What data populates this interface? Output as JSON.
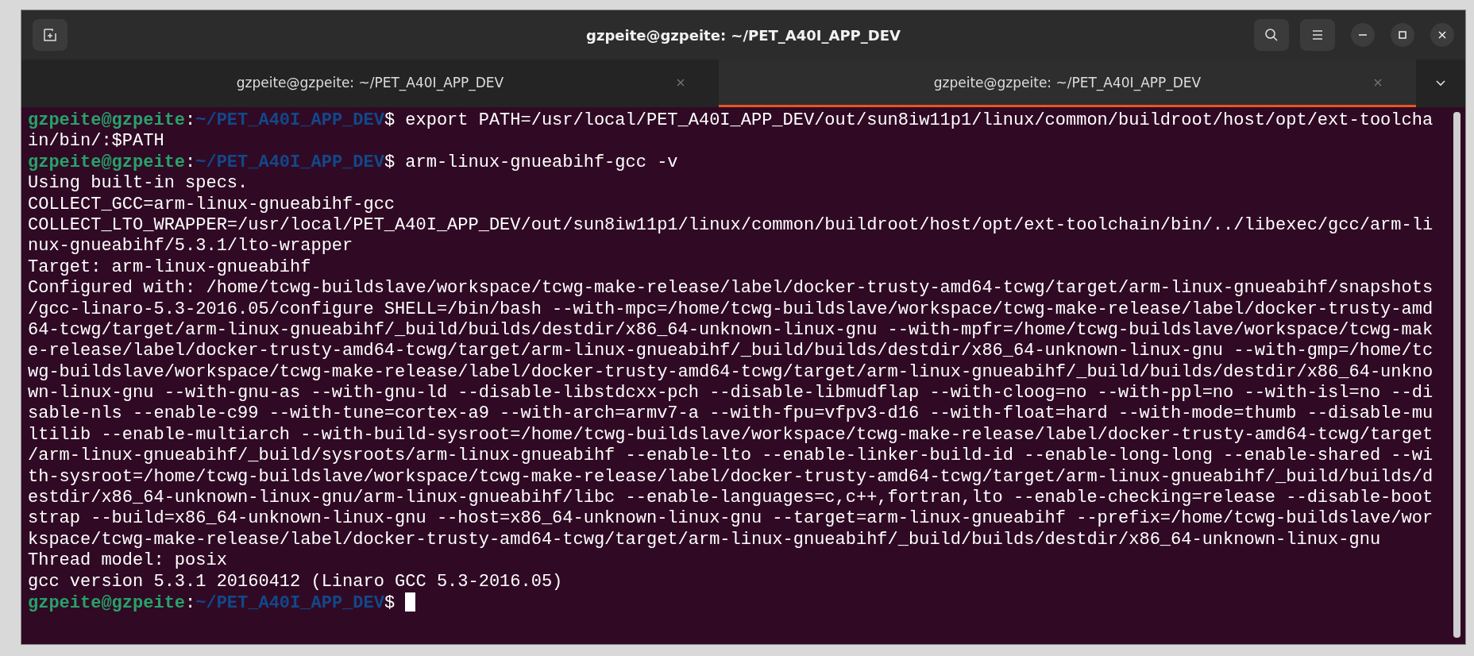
{
  "window": {
    "title": "gzpeite@gzpeite: ~/PET_A40I_APP_DEV"
  },
  "tabs": [
    {
      "label": "gzpeite@gzpeite: ~/PET_A40I_APP_DEV",
      "selected": false
    },
    {
      "label": "gzpeite@gzpeite: ~/PET_A40I_APP_DEV",
      "selected": true
    }
  ],
  "terminal": {
    "lines": [
      {
        "kind": "prompt",
        "user": "gzpeite@gzpeite",
        "separator": ":",
        "path": "~/PET_A40I_APP_DEV",
        "symbol": "$",
        "command": "export PATH=/usr/local/PET_A40I_APP_DEV/out/sun8iw11p1/linux/common/buildroot/host/opt/ext-toolcha",
        "cursor": false
      },
      {
        "kind": "output",
        "text": "in/bin/:$PATH"
      },
      {
        "kind": "prompt",
        "user": "gzpeite@gzpeite",
        "separator": ":",
        "path": "~/PET_A40I_APP_DEV",
        "symbol": "$",
        "command": "arm-linux-gnueabihf-gcc -v",
        "cursor": false
      },
      {
        "kind": "output",
        "text": "Using built-in specs."
      },
      {
        "kind": "output",
        "text": "COLLECT_GCC=arm-linux-gnueabihf-gcc"
      },
      {
        "kind": "output",
        "text": "COLLECT_LTO_WRAPPER=/usr/local/PET_A40I_APP_DEV/out/sun8iw11p1/linux/common/buildroot/host/opt/ext-toolchain/bin/../libexec/gcc/arm-li"
      },
      {
        "kind": "output",
        "text": "nux-gnueabihf/5.3.1/lto-wrapper"
      },
      {
        "kind": "output",
        "text": "Target: arm-linux-gnueabihf"
      },
      {
        "kind": "output",
        "text": "Configured with: /home/tcwg-buildslave/workspace/tcwg-make-release/label/docker-trusty-amd64-tcwg/target/arm-linux-gnueabihf/snapshots"
      },
      {
        "kind": "output",
        "text": "/gcc-linaro-5.3-2016.05/configure SHELL=/bin/bash --with-mpc=/home/tcwg-buildslave/workspace/tcwg-make-release/label/docker-trusty-amd"
      },
      {
        "kind": "output",
        "text": "64-tcwg/target/arm-linux-gnueabihf/_build/builds/destdir/x86_64-unknown-linux-gnu --with-mpfr=/home/tcwg-buildslave/workspace/tcwg-mak"
      },
      {
        "kind": "output",
        "text": "e-release/label/docker-trusty-amd64-tcwg/target/arm-linux-gnueabihf/_build/builds/destdir/x86_64-unknown-linux-gnu --with-gmp=/home/tc"
      },
      {
        "kind": "output",
        "text": "wg-buildslave/workspace/tcwg-make-release/label/docker-trusty-amd64-tcwg/target/arm-linux-gnueabihf/_build/builds/destdir/x86_64-unkno"
      },
      {
        "kind": "output",
        "text": "wn-linux-gnu --with-gnu-as --with-gnu-ld --disable-libstdcxx-pch --disable-libmudflap --with-cloog=no --with-ppl=no --with-isl=no --di"
      },
      {
        "kind": "output",
        "text": "sable-nls --enable-c99 --with-tune=cortex-a9 --with-arch=armv7-a --with-fpu=vfpv3-d16 --with-float=hard --with-mode=thumb --disable-mu"
      },
      {
        "kind": "output",
        "text": "ltilib --enable-multiarch --with-build-sysroot=/home/tcwg-buildslave/workspace/tcwg-make-release/label/docker-trusty-amd64-tcwg/target"
      },
      {
        "kind": "output",
        "text": "/arm-linux-gnueabihf/_build/sysroots/arm-linux-gnueabihf --enable-lto --enable-linker-build-id --enable-long-long --enable-shared --wi"
      },
      {
        "kind": "output",
        "text": "th-sysroot=/home/tcwg-buildslave/workspace/tcwg-make-release/label/docker-trusty-amd64-tcwg/target/arm-linux-gnueabihf/_build/builds/d"
      },
      {
        "kind": "output",
        "text": "estdir/x86_64-unknown-linux-gnu/arm-linux-gnueabihf/libc --enable-languages=c,c++,fortran,lto --enable-checking=release --disable-boot"
      },
      {
        "kind": "output",
        "text": "strap --build=x86_64-unknown-linux-gnu --host=x86_64-unknown-linux-gnu --target=arm-linux-gnueabihf --prefix=/home/tcwg-buildslave/wor"
      },
      {
        "kind": "output",
        "text": "kspace/tcwg-make-release/label/docker-trusty-amd64-tcwg/target/arm-linux-gnueabihf/_build/builds/destdir/x86_64-unknown-linux-gnu"
      },
      {
        "kind": "output",
        "text": "Thread model: posix"
      },
      {
        "kind": "output",
        "text": "gcc version 5.3.1 20160412 (Linaro GCC 5.3-2016.05)"
      },
      {
        "kind": "prompt",
        "user": "gzpeite@gzpeite",
        "separator": ":",
        "path": "~/PET_A40I_APP_DEV",
        "symbol": "$",
        "cursor": true
      }
    ]
  }
}
